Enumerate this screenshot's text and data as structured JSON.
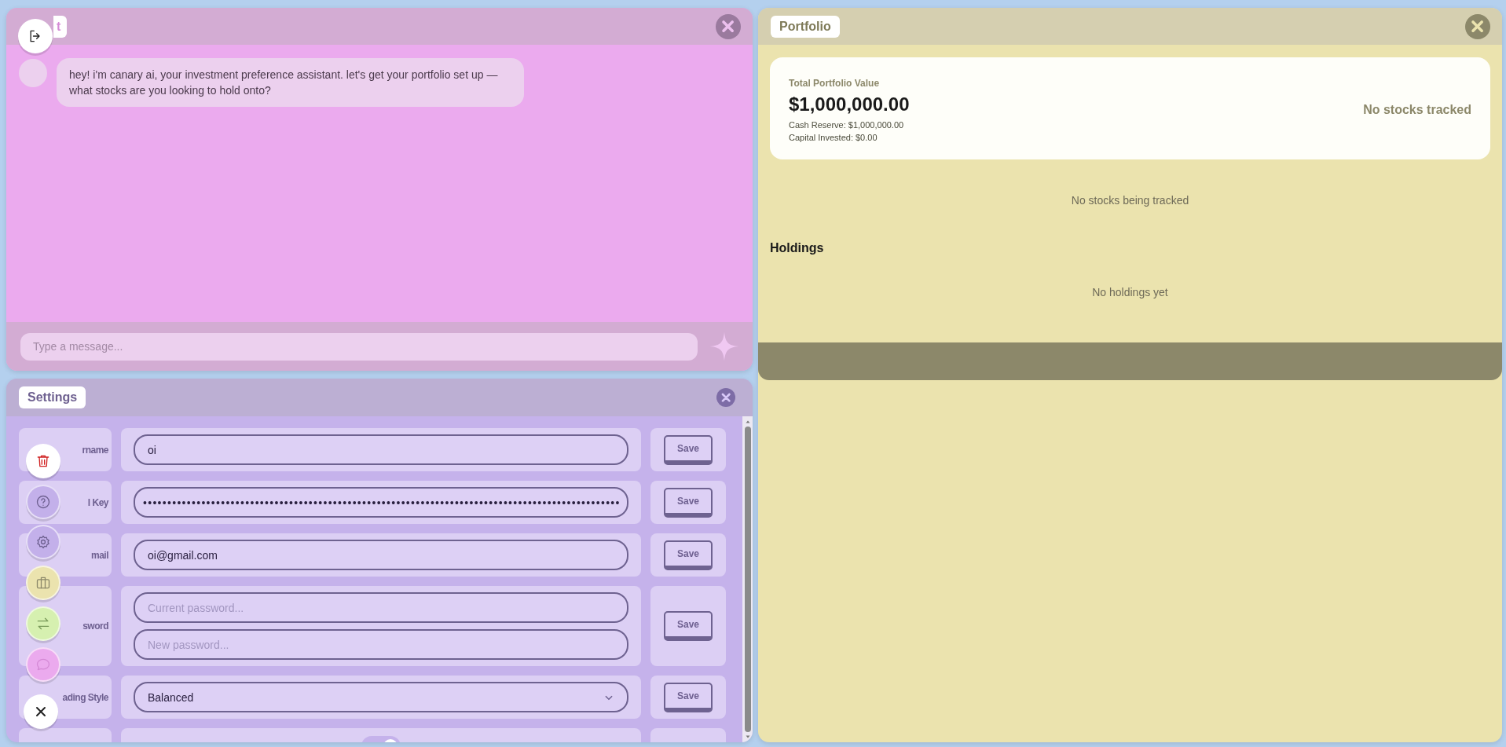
{
  "chat": {
    "title": "t",
    "messages": [
      {
        "text": "hey! i'm canary ai, your investment preference assistant. let's get your portfolio set up — what stocks are you looking to hold onto?"
      }
    ],
    "input": {
      "placeholder": "Type a message..."
    }
  },
  "settings": {
    "title": "Settings",
    "rows": [
      {
        "kind": "text",
        "label": "rname",
        "value": "oi",
        "button": "Save"
      },
      {
        "kind": "text",
        "label": "l Key",
        "value": "••••••••••••••••••••••••••••••••••••••••••••••••••••••••••••••••••••••••••••••••••••••••••••••••••",
        "button": "Save"
      },
      {
        "kind": "text",
        "label": "mail",
        "value": "oi@gmail.com",
        "button": "Save"
      },
      {
        "kind": "password",
        "label": "sword",
        "fields": [
          {
            "placeholder": "Current password..."
          },
          {
            "placeholder": "New password..."
          }
        ],
        "button": "Save"
      },
      {
        "kind": "select",
        "label": "ading Style",
        "value": "Balanced",
        "button": "Save"
      },
      {
        "kind": "toggle",
        "on": true
      }
    ]
  },
  "portfolio": {
    "title": "Portfolio",
    "summary_label": "Total Portfolio Value",
    "total": "$1,000,000.00",
    "cash_reserve": "Cash Reserve: $1,000,000.00",
    "capital_invested": "Capital Invested: $0.00",
    "status": "No stocks tracked",
    "stocks_empty": "No stocks being tracked",
    "holdings_heading": "Holdings",
    "holdings_empty": "No holdings yet"
  }
}
